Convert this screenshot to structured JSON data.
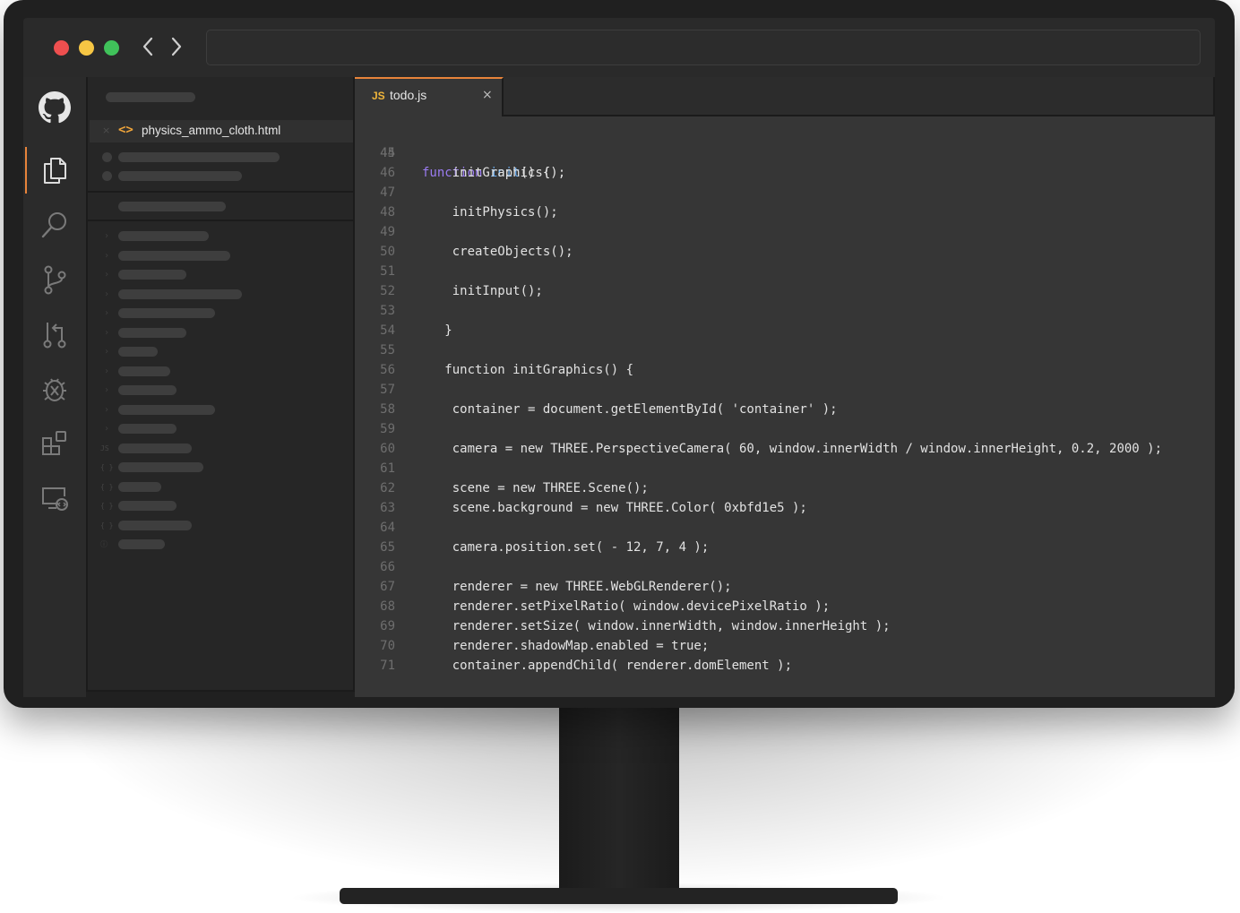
{
  "browser": {
    "back_label": "‹",
    "forward_label": "›",
    "address_value": ""
  },
  "activity_bar": {
    "items": [
      "github-icon",
      "files-icon",
      "search-icon",
      "source-control-icon",
      "pull-request-icon",
      "debug-icon",
      "extensions-icon",
      "remote-explorer-icon"
    ],
    "active": "files-icon",
    "accent_color": "#e8833a"
  },
  "sidebar": {
    "open_file": {
      "close_glyph": "×",
      "icon_glyph": "<>",
      "name": "physics_ammo_cloth.html"
    },
    "file_icons": [
      "JS",
      "{ }",
      "{ }",
      "{ }",
      "{ }",
      "ⓘ"
    ]
  },
  "editor": {
    "tab": {
      "badge": "JS",
      "name": "todo.js",
      "close_glyph": "×"
    },
    "lines": [
      {
        "n": "44",
        "code": "function init() {"
      },
      {
        "n": "45",
        "code": ""
      },
      {
        "n": "46",
        "code": "    initGraphics();"
      },
      {
        "n": "47",
        "code": ""
      },
      {
        "n": "48",
        "code": "    initPhysics();"
      },
      {
        "n": "49",
        "code": ""
      },
      {
        "n": "50",
        "code": "    createObjects();"
      },
      {
        "n": "51",
        "code": ""
      },
      {
        "n": "52",
        "code": "    initInput();"
      },
      {
        "n": "53",
        "code": ""
      },
      {
        "n": "54",
        "code": "   }"
      },
      {
        "n": "55",
        "code": ""
      },
      {
        "n": "56",
        "code": "   function initGraphics() {"
      },
      {
        "n": "57",
        "code": ""
      },
      {
        "n": "58",
        "code": "    container = document.getElementById( 'container' );"
      },
      {
        "n": "59",
        "code": ""
      },
      {
        "n": "60",
        "code": "    camera = new THREE.PerspectiveCamera( 60, window.innerWidth / window.innerHeight, 0.2, 2000 );"
      },
      {
        "n": "61",
        "code": ""
      },
      {
        "n": "62",
        "code": "    scene = new THREE.Scene();"
      },
      {
        "n": "63",
        "code": "    scene.background = new THREE.Color( 0xbfd1e5 );"
      },
      {
        "n": "64",
        "code": ""
      },
      {
        "n": "65",
        "code": "    camera.position.set( - 12, 7, 4 );"
      },
      {
        "n": "66",
        "code": ""
      },
      {
        "n": "67",
        "code": "    renderer = new THREE.WebGLRenderer();"
      },
      {
        "n": "68",
        "code": "    renderer.setPixelRatio( window.devicePixelRatio );"
      },
      {
        "n": "69",
        "code": "    renderer.setSize( window.innerWidth, window.innerHeight );"
      },
      {
        "n": "70",
        "code": "    renderer.shadowMap.enabled = true;"
      },
      {
        "n": "71",
        "code": "    container.appendChild( renderer.domElement );"
      }
    ],
    "syntax_colors": {
      "keyword": "#9b7cf2",
      "function": "#6cb0f5",
      "text": "#e2e2e2"
    },
    "first_line_tokens": {
      "keyword": "function",
      "name": "init",
      "rest": "() {"
    }
  }
}
